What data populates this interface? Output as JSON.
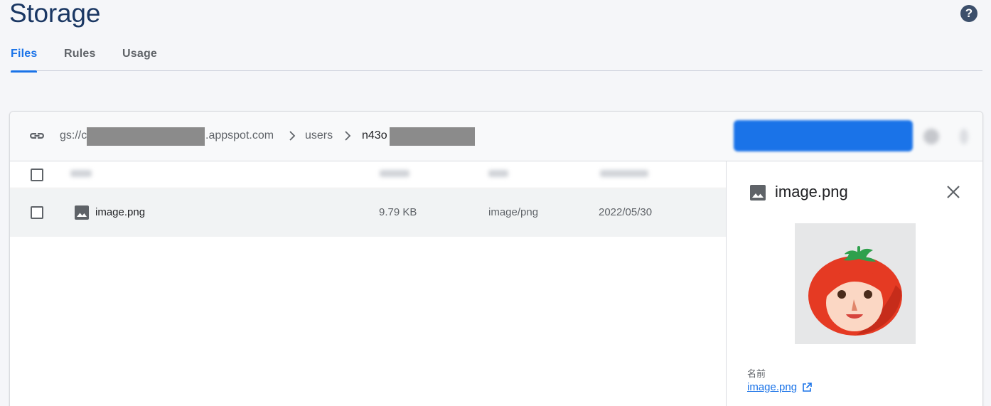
{
  "page": {
    "title": "Storage"
  },
  "help": {
    "icon": "help-icon",
    "glyph": "?"
  },
  "tabs": [
    {
      "label": "Files",
      "active": true
    },
    {
      "label": "Rules",
      "active": false
    },
    {
      "label": "Usage",
      "active": false
    }
  ],
  "path": {
    "prefix": "gs://c",
    "bucket_suffix": ".appspot.com",
    "folder": "users",
    "current": "n43o"
  },
  "files": [
    {
      "name": "image.png",
      "size": "9.79 KB",
      "type": "image/png",
      "modified": "2022/05/30"
    }
  ],
  "details": {
    "title": "image.png",
    "name_label": "名前",
    "name_link": "image.png"
  },
  "colors": {
    "accent": "#1a73e8",
    "title": "#1a3763"
  }
}
